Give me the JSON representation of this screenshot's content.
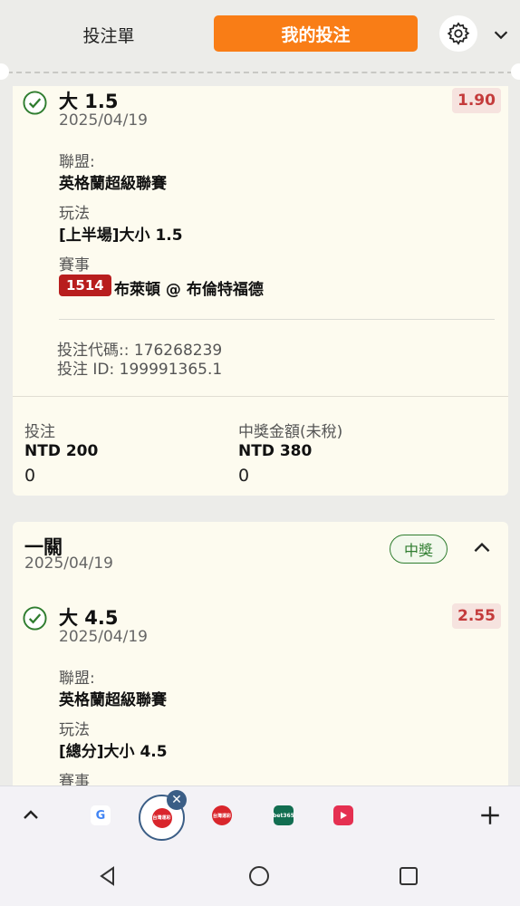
{
  "header": {
    "tab_slip": "投注單",
    "tab_mybets": "我的投注",
    "icons": {
      "settings": "gear-icon",
      "collapse": "chevron-down-icon"
    },
    "accent_color": "#f97d16"
  },
  "card1": {
    "selection": "大 1.5",
    "date": "2025/04/19",
    "odds": "1.90",
    "league_label": "聯盟:",
    "league": "英格蘭超級聯賽",
    "market_label": "玩法",
    "market": "[上半場]大小 1.5",
    "event_label": "賽事",
    "match_id": "1514",
    "match": "布萊頓 @ 布倫特福德",
    "bet_code": "投注代碼:: 176268239",
    "bet_id": "投注 ID: 199991365.1",
    "stake_label": "投注",
    "stake": "NTD 200",
    "stake_sub": "0",
    "payout_label": "中獎金額(未稅)",
    "payout": "NTD 380",
    "payout_sub": "0"
  },
  "card2": {
    "title": "一關",
    "date": "2025/04/19",
    "status": "中獎",
    "status_color": "#2f7d2f",
    "selection": "大 4.5",
    "sel_date": "2025/04/19",
    "odds": "2.55",
    "league_label": "聯盟:",
    "league": "英格蘭超級聯賽",
    "market_label": "玩法",
    "market": "[總分]大小 4.5",
    "event_label": "賽事"
  },
  "browser_bar": {
    "tabs": [
      {
        "name": "google",
        "text": "G"
      },
      {
        "name": "app-active",
        "text": "台灣運彩"
      },
      {
        "name": "app",
        "text": "台灣運彩"
      },
      {
        "name": "bet365",
        "text": "bet365"
      },
      {
        "name": "play",
        "text": ""
      }
    ]
  }
}
